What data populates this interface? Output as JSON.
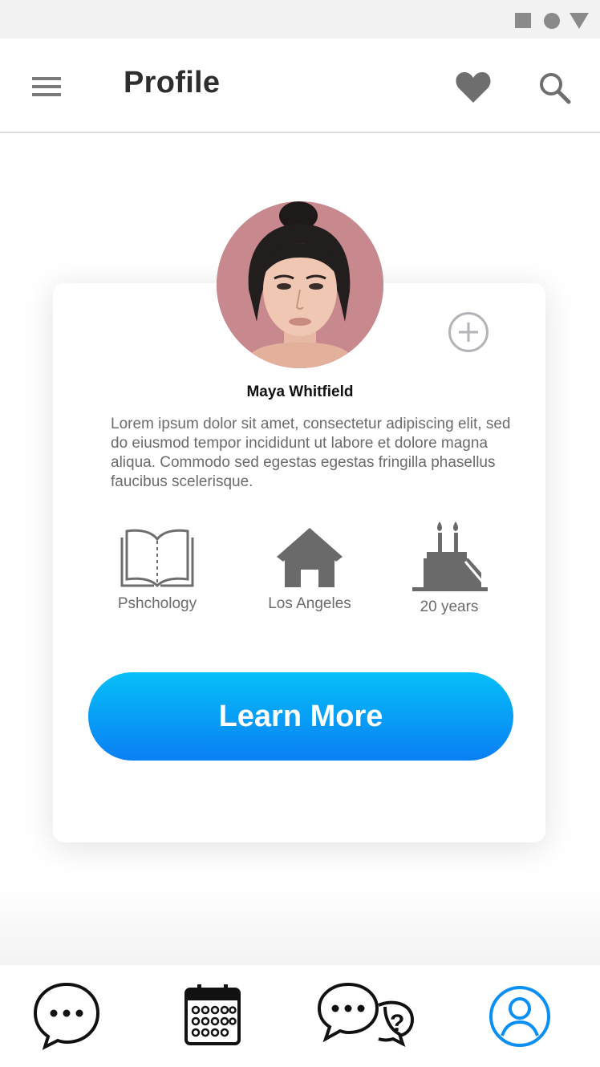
{
  "app": {
    "title": "Profile",
    "accent_color": "#0a8ff5"
  },
  "status_bar": {
    "icons": [
      "square-icon",
      "circle-icon",
      "triangle-icon"
    ]
  },
  "header": {
    "menu_icon": "hamburger-menu-icon",
    "title": "Profile",
    "actions": [
      "heart-icon",
      "search-icon"
    ]
  },
  "profile": {
    "name": "Maya Whitfield",
    "bio": "Lorem ipsum dolor sit amet, consectetur adipiscing elit, sed do eiusmod tempor incididunt ut labore et dolore magna aliqua. Commodo sed egestas egestas fringilla phasellus faucibus scelerisque.",
    "add_icon": "plus-circle-icon",
    "stats": [
      {
        "icon": "open-book-icon",
        "label": "Pshchology"
      },
      {
        "icon": "house-icon",
        "label": "Los Angeles"
      },
      {
        "icon": "birthday-cake-icon",
        "label": "20 years"
      }
    ],
    "cta_label": "Learn More"
  },
  "bottom_nav": {
    "items": [
      {
        "icon": "chat-bubble-icon",
        "active": false
      },
      {
        "icon": "calendar-icon",
        "active": false
      },
      {
        "icon": "question-chat-icon",
        "active": false
      },
      {
        "icon": "user-profile-icon",
        "active": true
      }
    ]
  }
}
